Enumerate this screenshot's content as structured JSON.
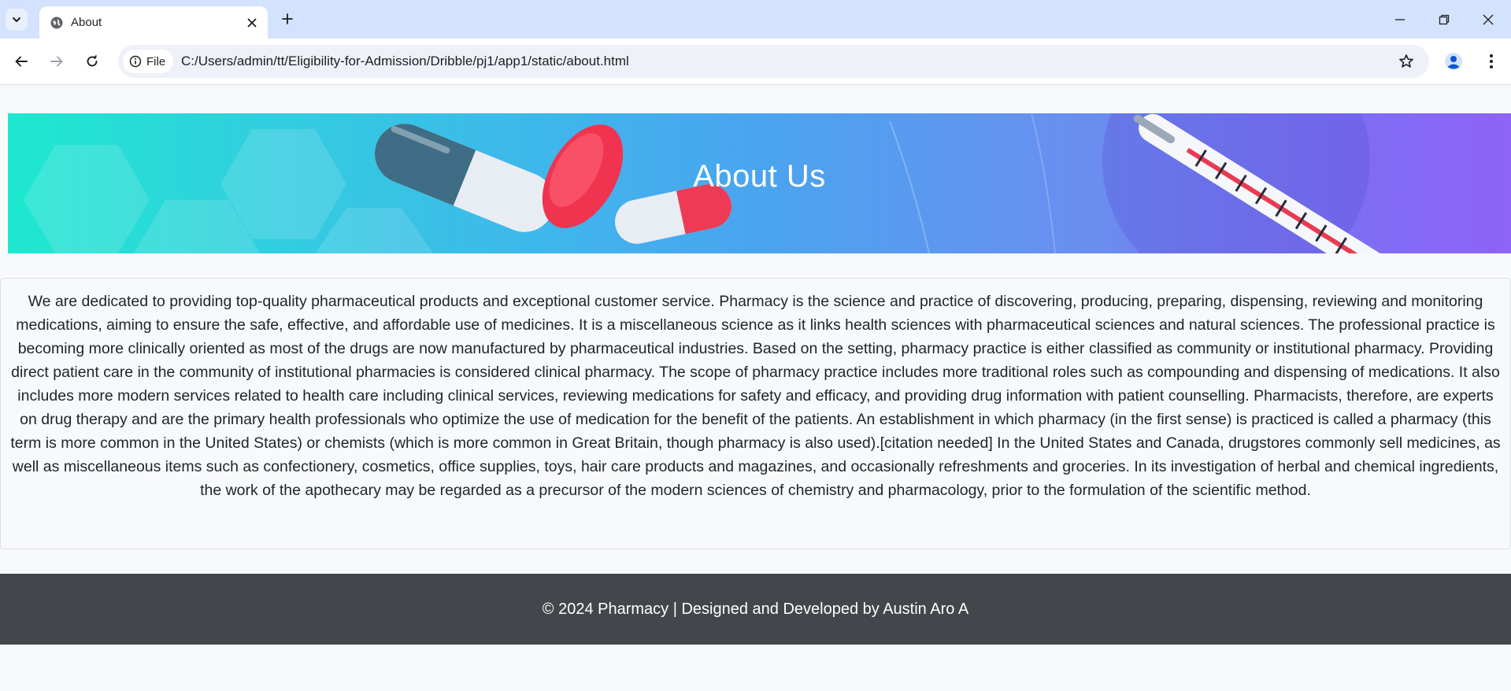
{
  "browser": {
    "tab_title": "About",
    "address_chip": "File",
    "url": "C:/Users/admin/tt/Eligibility-for-Admission/Dribble/pj1/app1/static/about.html"
  },
  "page": {
    "banner_title": "About Us",
    "about_text": "We are dedicated to providing top-quality pharmaceutical products and exceptional customer service. Pharmacy is the science and practice of discovering, producing, preparing, dispensing, reviewing and monitoring medications, aiming to ensure the safe, effective, and affordable use of medicines. It is a miscellaneous science as it links health sciences with pharmaceutical sciences and natural sciences. The professional practice is becoming more clinically oriented as most of the drugs are now manufactured by pharmaceutical industries. Based on the setting, pharmacy practice is either classified as community or institutional pharmacy. Providing direct patient care in the community of institutional pharmacies is considered clinical pharmacy. The scope of pharmacy practice includes more traditional roles such as compounding and dispensing of medications. It also includes more modern services related to health care including clinical services, reviewing medications for safety and efficacy, and providing drug information with patient counselling. Pharmacists, therefore, are experts on drug therapy and are the primary health professionals who optimize the use of medication for the benefit of the patients. An establishment in which pharmacy (in the first sense) is practiced is called a pharmacy (this term is more common in the United States) or chemists (which is more common in Great Britain, though pharmacy is also used).[citation needed] In the United States and Canada, drugstores commonly sell medicines, as well as miscellaneous items such as confectionery, cosmetics, office supplies, toys, hair care products and magazines, and occasionally refreshments and groceries. In its investigation of herbal and chemical ingredients, the work of the apothecary may be regarded as a precursor of the modern sciences of chemistry and pharmacology, prior to the formulation of the scientific method.",
    "footer_text": "© 2024 Pharmacy | Designed and Developed by Austin Aro A"
  },
  "colors": {
    "tabstrip_bg": "#d3e3fd",
    "footer_bg": "#43474c",
    "banner_start": "#1ee8cf",
    "banner_end": "#8e63f5"
  },
  "icons": [
    "tab-search-icon",
    "globe-icon",
    "close-icon",
    "plus-icon",
    "minimize-icon",
    "restore-icon",
    "back-icon",
    "forward-icon",
    "reload-icon",
    "info-icon",
    "star-icon",
    "profile-icon",
    "more-icon"
  ]
}
